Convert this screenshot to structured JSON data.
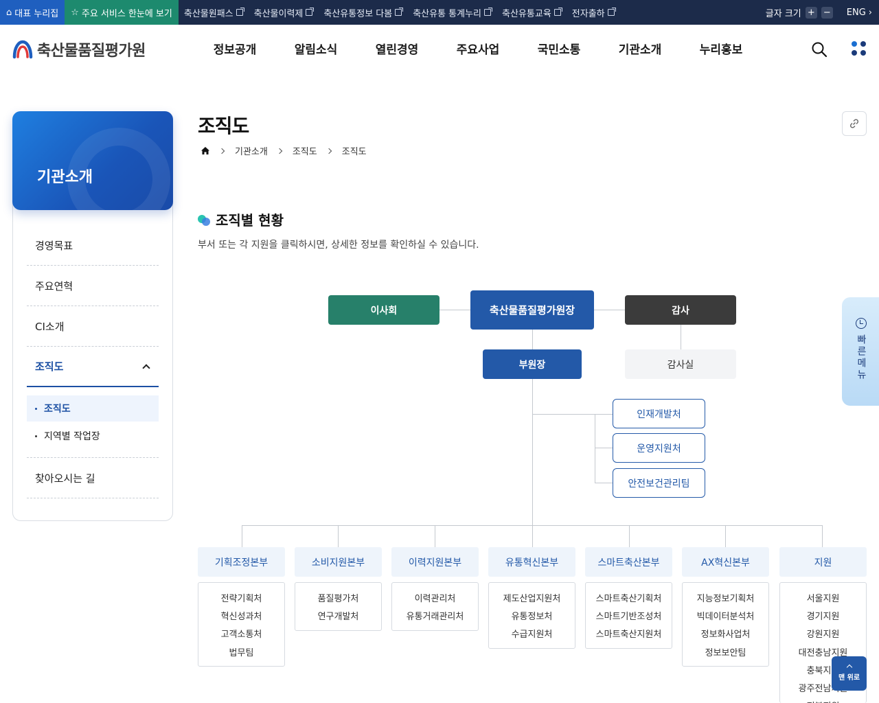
{
  "topbar": {
    "main": "대표 누리집",
    "service": "주요 서비스 한눈에 보기",
    "links": [
      "축산물원패스",
      "축산물이력제",
      "축산유통정보 다봄",
      "축산유통 통계누리",
      "축산유통교육",
      "전자출하"
    ],
    "font_size_label": "글자 크기",
    "plus": "+",
    "minus": "−",
    "eng": "ENG"
  },
  "header": {
    "logo_text": "축산물품질평가원",
    "gnb": [
      "정보공개",
      "알림소식",
      "열린경영",
      "주요사업",
      "국민소통",
      "기관소개",
      "누리홍보"
    ]
  },
  "lnb": {
    "title": "기관소개",
    "items": [
      "경영목표",
      "주요연혁",
      "CI소개",
      "조직도",
      "찾아오시는 길"
    ],
    "sub_items": [
      "조직도",
      "지역별 작업장"
    ]
  },
  "content": {
    "page_title": "조직도",
    "breadcrumb": [
      "기관소개",
      "조직도",
      "조직도"
    ],
    "section_title": "조직별 현황",
    "section_desc": "부서 또는 각 지원을 클릭하시면, 상세한 정보를 확인하실 수 있습니다."
  },
  "org": {
    "board": "이사회",
    "ceo": "축산물품질평가원장",
    "audit": "감사",
    "vp": "부원장",
    "audit_office": "감사실",
    "staff": [
      "인재개발처",
      "운영지원처",
      "안전보건관리팀"
    ],
    "hqs": [
      {
        "name": "기획조정본부",
        "depts": [
          "전략기획처",
          "혁신성과처",
          "고객소통처",
          "법무팀"
        ]
      },
      {
        "name": "소비지원본부",
        "depts": [
          "품질평가처",
          "연구개발처"
        ]
      },
      {
        "name": "이력지원본부",
        "depts": [
          "이력관리처",
          "유통거래관리처"
        ]
      },
      {
        "name": "유통혁신본부",
        "depts": [
          "제도산업지원처",
          "유통정보처",
          "수급지원처"
        ]
      },
      {
        "name": "스마트축산본부",
        "depts": [
          "스마트축산기획처",
          "스마트기반조성처",
          "스마트축산지원처"
        ]
      },
      {
        "name": "AX혁신본부",
        "depts": [
          "지능정보기획처",
          "빅데이터분석처",
          "정보화사업처",
          "정보보안팀"
        ]
      },
      {
        "name": "지원",
        "depts": [
          "서울지원",
          "경기지원",
          "강원지원",
          "대전충남지원",
          "충북지원",
          "광주전남지원",
          "전북지원"
        ]
      }
    ]
  },
  "quick_menu": "빠른메뉴",
  "to_top": "맨 위로",
  "colors": {
    "primary": "#2359a8",
    "board": "#27806a",
    "audit": "#3b3b3b",
    "topbar": "#1c2b4a"
  }
}
